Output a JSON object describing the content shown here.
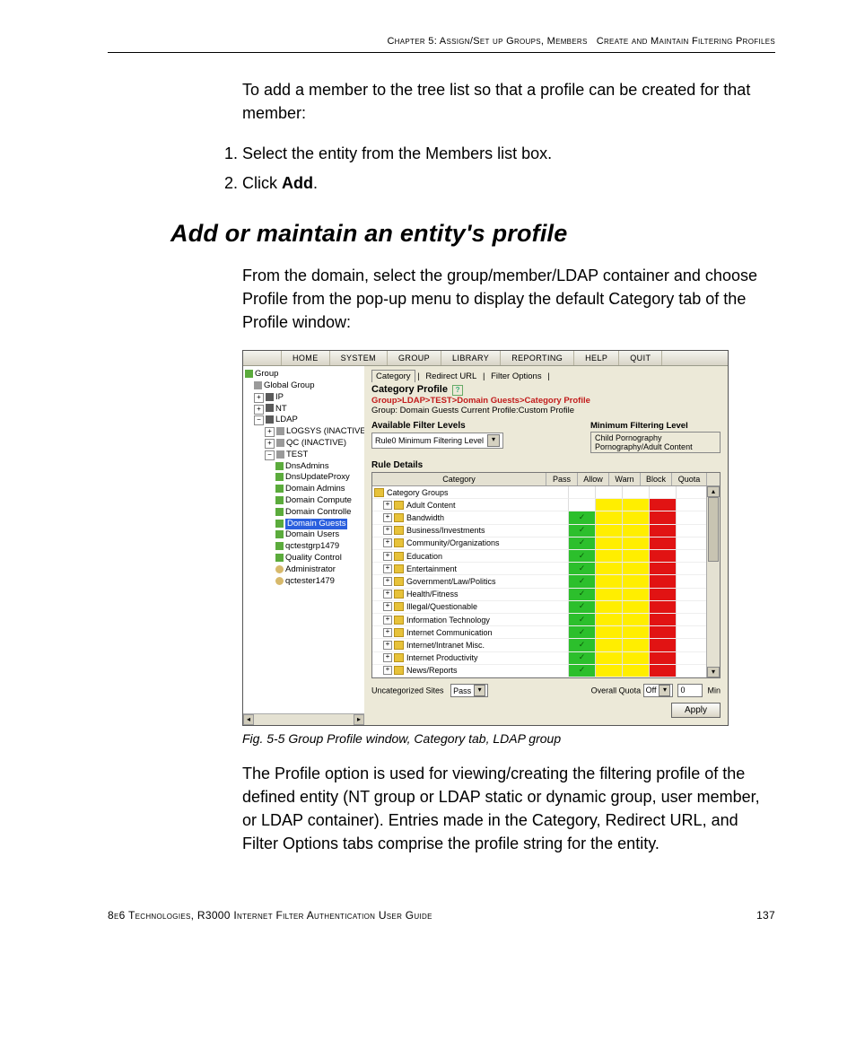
{
  "header": {
    "chapter": "Chapter 5: Assign/Set up Groups, Members",
    "section": "Create and Maintain Filtering Profiles"
  },
  "intro": "To add a member to the tree list so that a profile can be created for that member:",
  "steps": {
    "1": "Select the entity from the Members list box.",
    "2_prefix": "Click ",
    "2_bold": "Add",
    "2_suffix": "."
  },
  "heading": "Add or maintain an entity's profile",
  "para1": "From the domain, select the group/member/LDAP container and choose Profile from the pop-up menu to display the default Category tab of the Profile window:",
  "app": {
    "menu": [
      "HOME",
      "SYSTEM",
      "GROUP",
      "LIBRARY",
      "REPORTING",
      "HELP",
      "QUIT"
    ],
    "tree": [
      {
        "ind": 0,
        "exp": "",
        "icon": "ic-green",
        "label": "Group"
      },
      {
        "ind": 1,
        "exp": "",
        "icon": "ic-gray",
        "label": "Global Group"
      },
      {
        "ind": 1,
        "exp": "+",
        "icon": "ic-dark",
        "label": "IP"
      },
      {
        "ind": 1,
        "exp": "+",
        "icon": "ic-dark",
        "label": "NT"
      },
      {
        "ind": 1,
        "exp": "−",
        "icon": "ic-dark",
        "label": "LDAP"
      },
      {
        "ind": 2,
        "exp": "+",
        "icon": "ic-gray",
        "label": "LOGSYS (INACTIVE)"
      },
      {
        "ind": 2,
        "exp": "+",
        "icon": "ic-gray",
        "label": "QC (INACTIVE)"
      },
      {
        "ind": 2,
        "exp": "−",
        "icon": "ic-gray",
        "label": "TEST"
      },
      {
        "ind": 3,
        "exp": "",
        "icon": "ic-green",
        "label": "DnsAdmins"
      },
      {
        "ind": 3,
        "exp": "",
        "icon": "ic-green",
        "label": "DnsUpdateProxy"
      },
      {
        "ind": 3,
        "exp": "",
        "icon": "ic-green",
        "label": "Domain Admins"
      },
      {
        "ind": 3,
        "exp": "",
        "icon": "ic-green",
        "label": "Domain Compute"
      },
      {
        "ind": 3,
        "exp": "",
        "icon": "ic-green",
        "label": "Domain Controlle"
      },
      {
        "ind": 3,
        "exp": "",
        "icon": "ic-green",
        "label": "Domain Guests",
        "sel": true
      },
      {
        "ind": 3,
        "exp": "",
        "icon": "ic-green",
        "label": "Domain Users"
      },
      {
        "ind": 3,
        "exp": "",
        "icon": "ic-green",
        "label": "qctestgrp1479"
      },
      {
        "ind": 3,
        "exp": "",
        "icon": "ic-green",
        "label": "Quality Control"
      },
      {
        "ind": 3,
        "exp": "",
        "icon": "ic-user",
        "label": "Administrator"
      },
      {
        "ind": 3,
        "exp": "",
        "icon": "ic-user",
        "label": "qctester1479"
      }
    ],
    "tabs": {
      "active": "Category",
      "others": [
        "Redirect URL",
        "Filter Options"
      ]
    },
    "cp_title": "Category Profile",
    "breadcrumb": "Group>LDAP>TEST>Domain Guests>Category Profile",
    "subline": "Group: Domain Guests   Current Profile:Custom Profile",
    "afl_label": "Available Filter Levels",
    "afl_value": "Rule0 Minimum Filtering Level",
    "mfl_title": "Minimum Filtering Level",
    "mfl_items": [
      "Child Pornography",
      "Pornography/Adult Content"
    ],
    "rule_details": "Rule Details",
    "grid_headers": {
      "cat": "Category",
      "pass": "Pass",
      "allow": "Allow",
      "warn": "Warn",
      "block": "Block",
      "quota": "Quota"
    },
    "categories_header": "Category Groups",
    "categories": [
      "Adult Content",
      "Bandwidth",
      "Business/Investments",
      "Community/Organizations",
      "Education",
      "Entertainment",
      "Government/Law/Politics",
      "Health/Fitness",
      "Illegal/Questionable",
      "Information Technology",
      "Internet Communication",
      "Internet/Intranet Misc.",
      "Internet Productivity",
      "News/Reports"
    ],
    "uncat_label": "Uncategorized Sites",
    "uncat_value": "Pass",
    "oq_label": "Overall Quota",
    "oq_value": "Off",
    "oq_num": "0",
    "oq_unit": "Min",
    "apply": "Apply"
  },
  "fig_caption": "Fig. 5-5  Group Profile window, Category tab, LDAP group",
  "para2": "The Profile option is used for viewing/creating the filtering profile of the defined entity (NT group or LDAP static or dynamic group, user member, or LDAP container). Entries made in the Category, Redirect URL, and Filter Options tabs comprise the profile string for the entity.",
  "footer": {
    "left": "8e6 Technologies, R3000 Internet Filter Authentication User Guide",
    "right": "137"
  },
  "chart_data": {
    "type": "table",
    "categories": [
      "Adult Content",
      "Bandwidth",
      "Business/Investments",
      "Community/Organizations",
      "Education",
      "Entertainment",
      "Government/Law/Politics",
      "Health/Fitness",
      "Illegal/Questionable",
      "Information Technology",
      "Internet Communication",
      "Internet/Intranet Misc.",
      "Internet Productivity",
      "News/Reports"
    ],
    "columns": [
      "Pass",
      "Allow",
      "Warn",
      "Block",
      "Quota"
    ],
    "states": {
      "Adult Content": {
        "Pass": "blank",
        "Allow": "yellow",
        "Warn": "yellow",
        "Block": "red",
        "Quota": "blank"
      },
      "Bandwidth": {
        "Pass": "green",
        "Allow": "yellow",
        "Warn": "yellow",
        "Block": "red",
        "Quota": "blank"
      },
      "Business/Investments": {
        "Pass": "green",
        "Allow": "yellow",
        "Warn": "yellow",
        "Block": "red",
        "Quota": "blank"
      },
      "Community/Organizations": {
        "Pass": "green",
        "Allow": "yellow",
        "Warn": "yellow",
        "Block": "red",
        "Quota": "blank"
      },
      "Education": {
        "Pass": "green",
        "Allow": "yellow",
        "Warn": "yellow",
        "Block": "red",
        "Quota": "blank"
      },
      "Entertainment": {
        "Pass": "green",
        "Allow": "yellow",
        "Warn": "yellow",
        "Block": "red",
        "Quota": "blank"
      },
      "Government/Law/Politics": {
        "Pass": "green",
        "Allow": "yellow",
        "Warn": "yellow",
        "Block": "red",
        "Quota": "blank"
      },
      "Health/Fitness": {
        "Pass": "green",
        "Allow": "yellow",
        "Warn": "yellow",
        "Block": "red",
        "Quota": "blank"
      },
      "Illegal/Questionable": {
        "Pass": "green",
        "Allow": "yellow",
        "Warn": "yellow",
        "Block": "red",
        "Quota": "blank"
      },
      "Information Technology": {
        "Pass": "green",
        "Allow": "yellow",
        "Warn": "yellow",
        "Block": "red",
        "Quota": "blank"
      },
      "Internet Communication": {
        "Pass": "green",
        "Allow": "yellow",
        "Warn": "yellow",
        "Block": "red",
        "Quota": "blank"
      },
      "Internet/Intranet Misc.": {
        "Pass": "green",
        "Allow": "yellow",
        "Warn": "yellow",
        "Block": "red",
        "Quota": "blank"
      },
      "Internet Productivity": {
        "Pass": "green",
        "Allow": "yellow",
        "Warn": "yellow",
        "Block": "red",
        "Quota": "blank"
      },
      "News/Reports": {
        "Pass": "green",
        "Allow": "yellow",
        "Warn": "yellow",
        "Block": "red",
        "Quota": "blank"
      }
    }
  }
}
